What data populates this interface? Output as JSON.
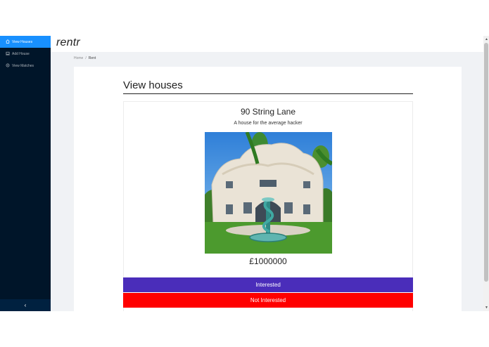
{
  "app": {
    "logo": "rentr"
  },
  "sidebar": {
    "items": [
      {
        "label": "View Houses",
        "icon": "home-icon",
        "active": true
      },
      {
        "label": "Add House",
        "icon": "laptop-icon",
        "active": false
      },
      {
        "label": "View Matches",
        "icon": "settings-icon",
        "active": false
      }
    ],
    "collapse_glyph": "‹"
  },
  "breadcrumb": {
    "home": "Home",
    "separator": "/",
    "current": "Rent"
  },
  "page": {
    "title": "View houses"
  },
  "house": {
    "name": "90 String Lane",
    "description": "A house for the average hacker",
    "price": "£1000000"
  },
  "actions": {
    "interested": "Interested",
    "not_interested": "Not Interested"
  },
  "colors": {
    "sidebar": "#001529",
    "active": "#1890ff",
    "interested": "#4a2dba",
    "not_interested": "#ff0000"
  }
}
